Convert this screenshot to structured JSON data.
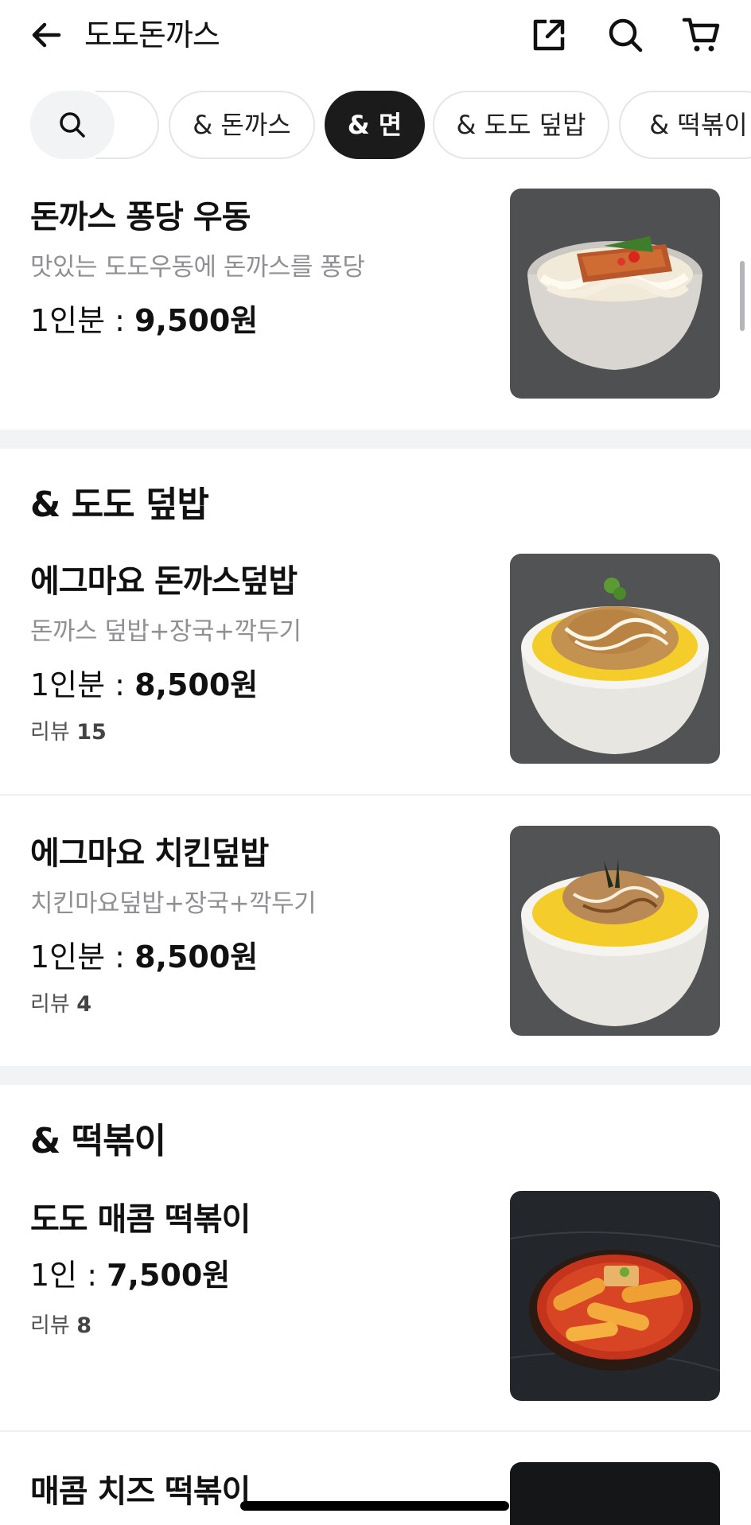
{
  "header": {
    "title": "도도돈까스",
    "icons": [
      "back-arrow-icon",
      "share-icon",
      "search-icon",
      "cart-icon"
    ]
  },
  "category_tabs": {
    "search_icon": "search-icon",
    "partial_tab": "",
    "items": [
      {
        "label": "& 돈까스",
        "active": false
      },
      {
        "label": "& 면",
        "active": true
      },
      {
        "label": "& 도도 덮밥",
        "active": false
      },
      {
        "label": "& 떡볶이",
        "active": false
      }
    ]
  },
  "sections": [
    {
      "title": "",
      "items": [
        {
          "name": "돈까스 퐁당 우동",
          "description": "맛있는 도도우동에 돈까스를 퐁당",
          "price_unit": "1인분 : ",
          "price": "9,500원",
          "review_label": "",
          "review_count": ""
        }
      ]
    },
    {
      "title": "& 도도 덮밥",
      "items": [
        {
          "name": "에그마요 돈까스덮밥",
          "description": "돈까스 덮밥+장국+깍두기",
          "price_unit": "1인분 : ",
          "price": "8,500원",
          "review_label": "리뷰 ",
          "review_count": "15"
        },
        {
          "name": "에그마요 치킨덮밥",
          "description": "치킨마요덮밥+장국+깍두기",
          "price_unit": "1인분 : ",
          "price": "8,500원",
          "review_label": "리뷰 ",
          "review_count": "4"
        }
      ]
    },
    {
      "title": "& 떡볶이",
      "items": [
        {
          "name": "도도 매콤 떡볶이",
          "description": "",
          "price_unit": "1인 : ",
          "price": "7,500원",
          "review_label": "리뷰 ",
          "review_count": "8"
        },
        {
          "name": "매콤 치즈 떡볶이",
          "description": "",
          "price_unit": "",
          "price": "",
          "review_label": "",
          "review_count": ""
        }
      ]
    }
  ],
  "colors": {
    "active_tab_bg": "#1b1b1c",
    "divider": "#f2f3f5",
    "description_text": "#8e9094"
  }
}
